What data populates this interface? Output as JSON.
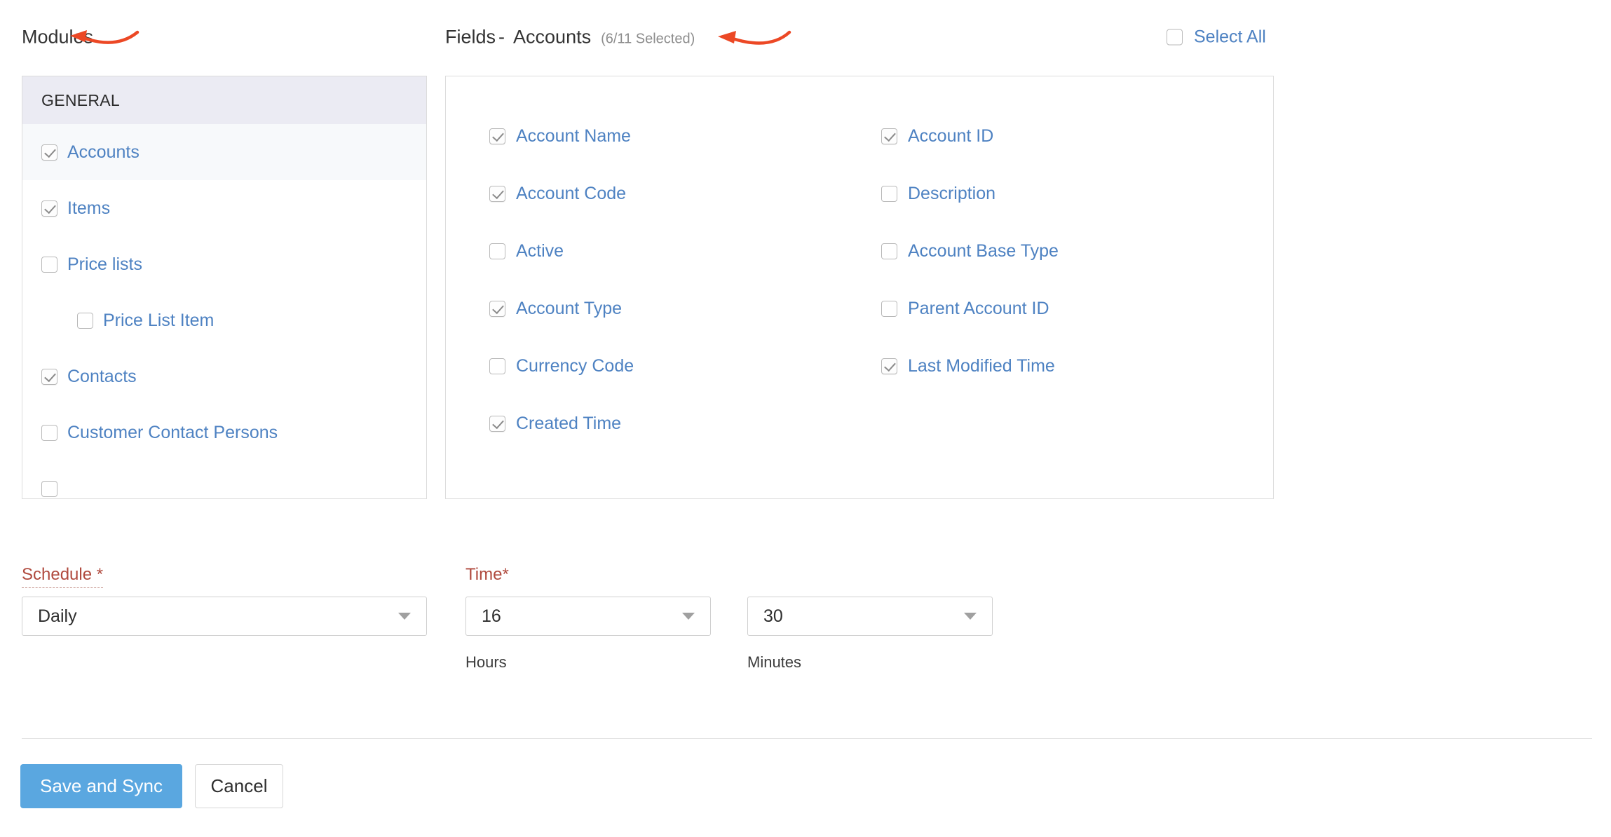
{
  "modules": {
    "heading": "Modules",
    "group_label": "GENERAL",
    "items": [
      {
        "label": "Accounts",
        "checked": true,
        "indent": false,
        "active": true
      },
      {
        "label": "Items",
        "checked": true,
        "indent": false,
        "active": false
      },
      {
        "label": "Price lists",
        "checked": false,
        "indent": false,
        "active": false
      },
      {
        "label": "Price List Item",
        "checked": false,
        "indent": true,
        "active": false
      },
      {
        "label": "Contacts",
        "checked": true,
        "indent": false,
        "active": false
      },
      {
        "label": "Customer Contact Persons",
        "checked": false,
        "indent": false,
        "active": false
      }
    ]
  },
  "fields": {
    "heading": "Fields",
    "separator": "-",
    "module_name": "Accounts",
    "count_text": "(6/11 Selected)",
    "select_all": {
      "label": "Select All",
      "checked": false
    },
    "columns": [
      [
        {
          "label": "Account Name",
          "checked": true
        },
        {
          "label": "Account Code",
          "checked": true
        },
        {
          "label": "Active",
          "checked": false
        },
        {
          "label": "Account Type",
          "checked": true
        },
        {
          "label": "Currency Code",
          "checked": false
        },
        {
          "label": "Created Time",
          "checked": true
        }
      ],
      [
        {
          "label": "Account ID",
          "checked": true
        },
        {
          "label": "Description",
          "checked": false
        },
        {
          "label": "Account Base Type",
          "checked": false
        },
        {
          "label": "Parent Account ID",
          "checked": false
        },
        {
          "label": "Last Modified Time",
          "checked": true
        }
      ]
    ]
  },
  "form": {
    "schedule": {
      "label": "Schedule *",
      "value": "Daily"
    },
    "time": {
      "label": "Time*",
      "hours": {
        "value": "16",
        "sub_label": "Hours"
      },
      "minutes": {
        "value": "30",
        "sub_label": "Minutes"
      }
    }
  },
  "footer": {
    "save_label": "Save and Sync",
    "cancel_label": "Cancel"
  },
  "annotations": {
    "arrow_color": "#ec4825",
    "arrows": [
      {
        "name": "modules-arrow"
      },
      {
        "name": "fields-arrow"
      }
    ]
  }
}
